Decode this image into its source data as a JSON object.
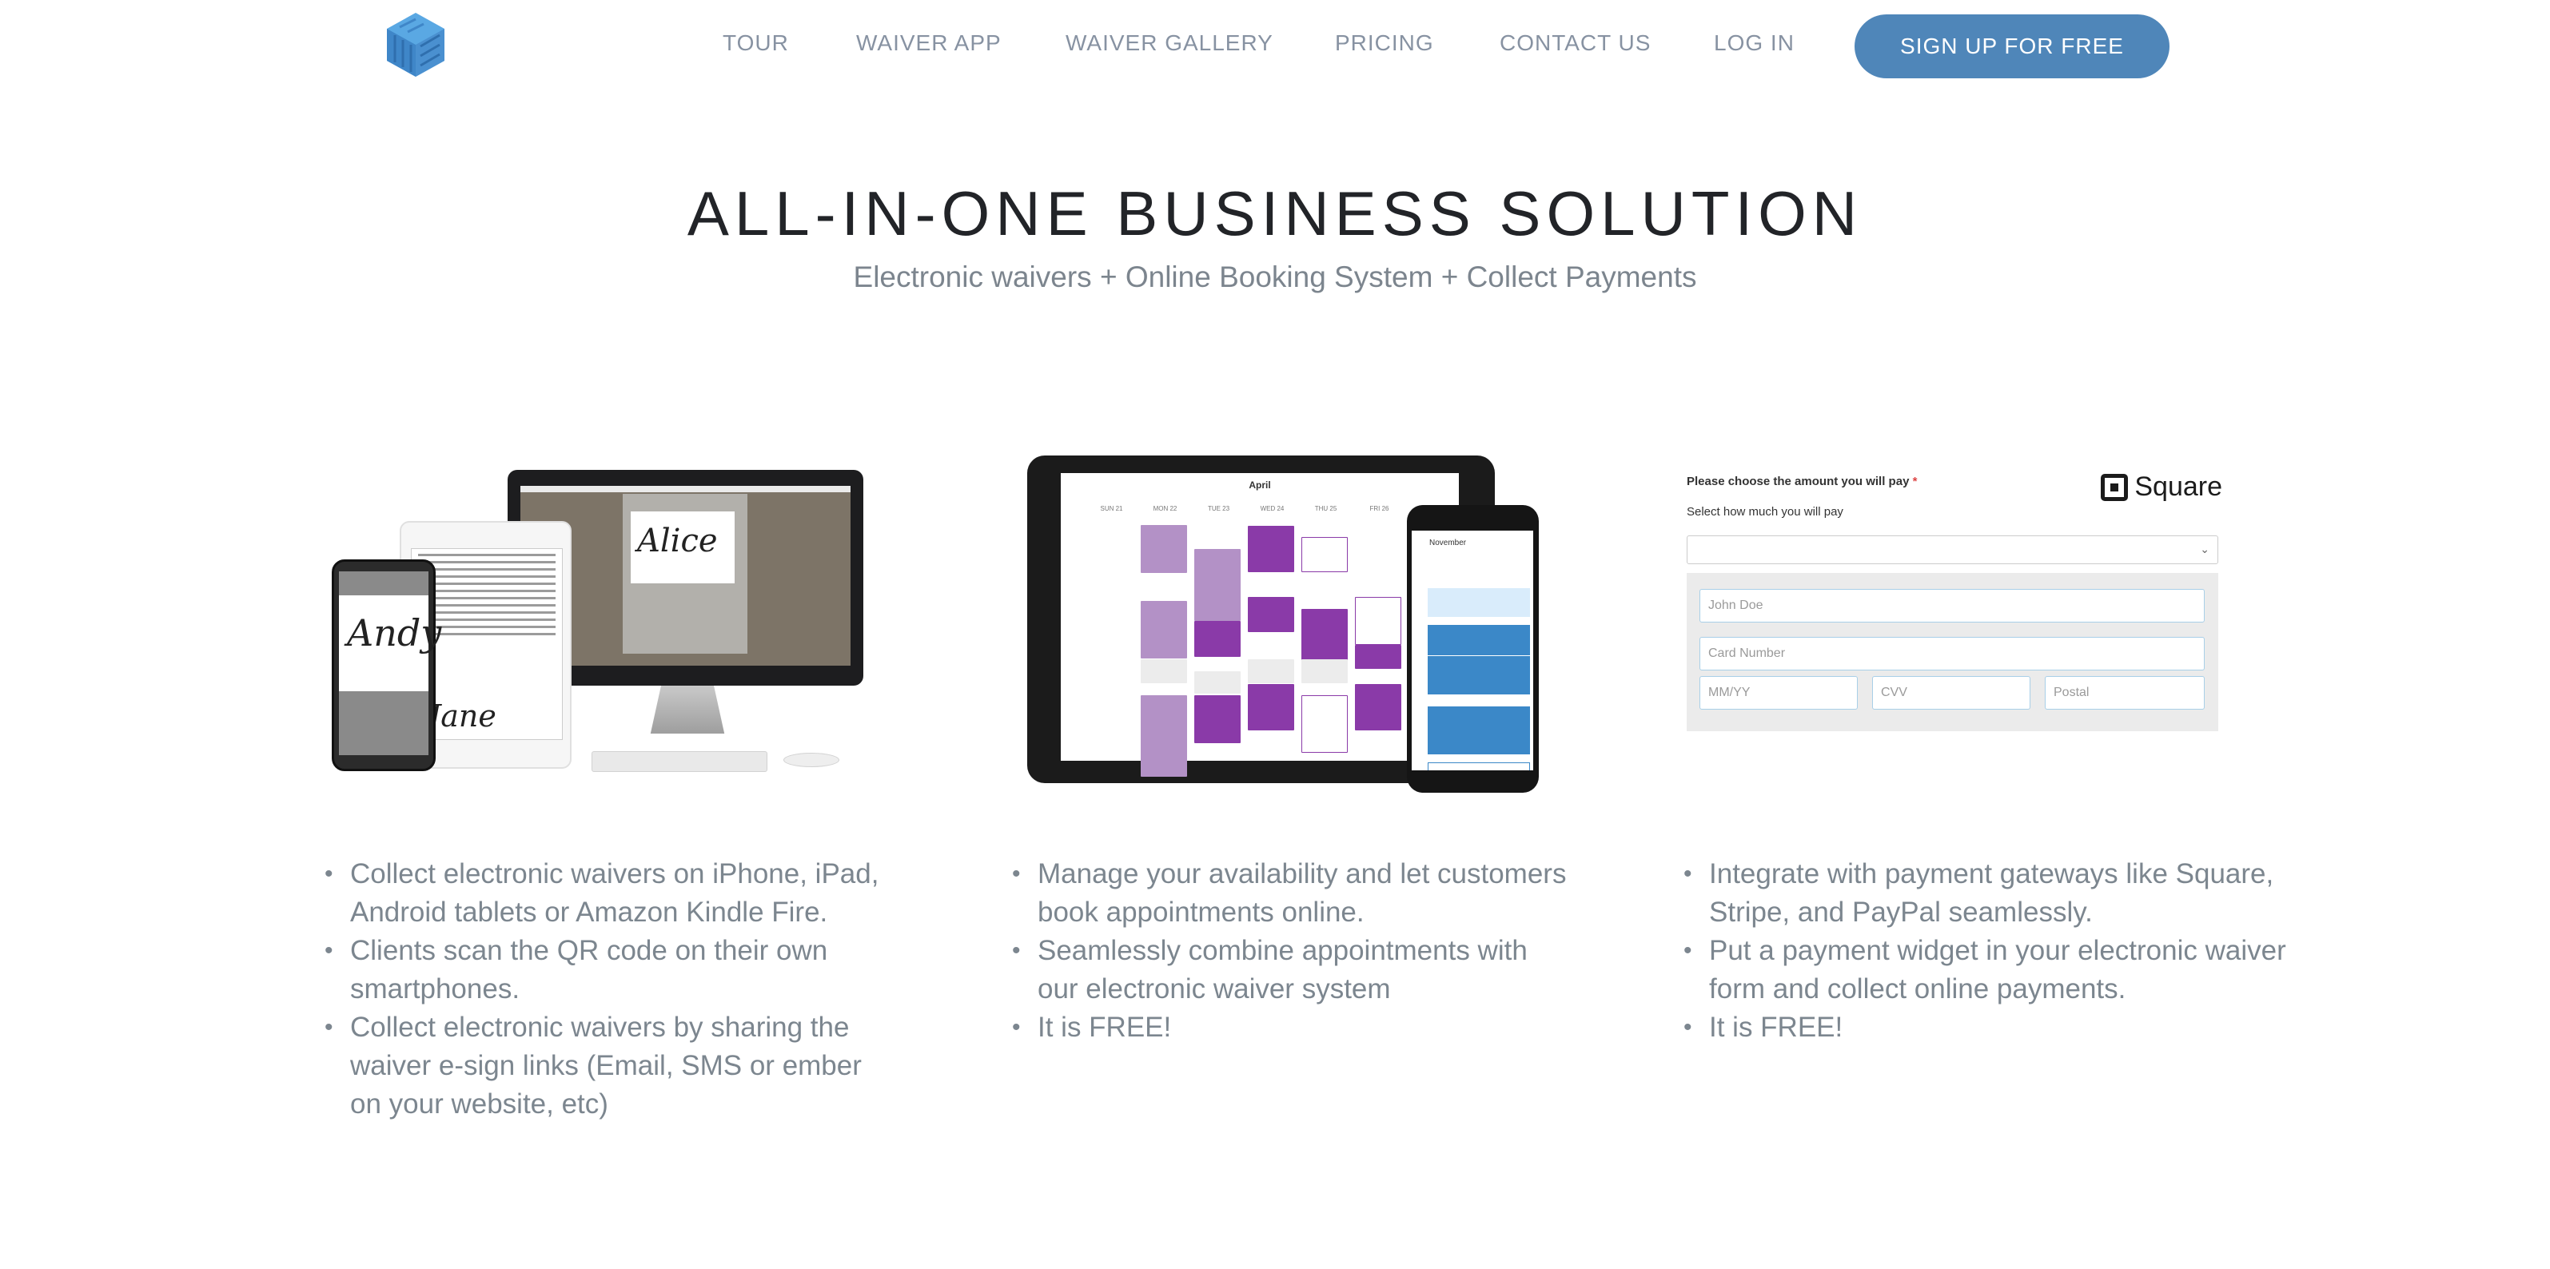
{
  "header": {
    "logo_alt": "logo-icon",
    "nav": [
      {
        "label": "TOUR"
      },
      {
        "label": "WAIVER APP"
      },
      {
        "label": "WAIVER GALLERY"
      },
      {
        "label": "PRICING"
      },
      {
        "label": "CONTACT US"
      },
      {
        "label": "LOG IN"
      }
    ],
    "signup_label": "SIGN UP FOR FREE",
    "accent_color": "#4f86b9"
  },
  "hero": {
    "title": "ALL-IN-ONE BUSINESS SOLUTION",
    "subtitle": "Electronic waivers + Online Booking System + Collect Payments"
  },
  "features": [
    {
      "visual": "devices-signature-illustration",
      "signatures": [
        "Alice",
        "Jane",
        "Andy"
      ],
      "bullets": [
        "Collect electronic waivers on iPhone, iPad, Android tablets or Amazon Kindle Fire.",
        "Clients scan the QR code on their own smartphones.",
        "Collect electronic waivers by sharing the waiver e-sign links (Email, SMS or ember on your website, etc)"
      ]
    },
    {
      "visual": "booking-calendar-illustration",
      "calendar": {
        "month": "April",
        "days": [
          "SUN 21",
          "MON 22",
          "TUE 23",
          "WED 24",
          "THU 25",
          "FRI 26"
        ],
        "phone_month": "November"
      },
      "bullets": [
        "Manage your availability and let customers book appointments online.",
        "Seamlessly combine appointments with our electronic waiver system",
        "It is FREE!"
      ]
    },
    {
      "visual": "square-payment-form",
      "form": {
        "label": "Please choose the amount you will pay",
        "required_mark": "*",
        "sublabel": "Select how much you will pay",
        "brand": "Square",
        "name_placeholder": "John Doe",
        "card_placeholder": "Card Number",
        "exp_placeholder": "MM/YY",
        "cvv_placeholder": "CVV",
        "postal_placeholder": "Postal"
      },
      "bullets": [
        "Integrate with payment gateways like Square, Stripe, and PayPal seamlessly.",
        "Put a payment widget in your electronic waiver form and collect online payments.",
        "It is FREE!"
      ]
    }
  ]
}
